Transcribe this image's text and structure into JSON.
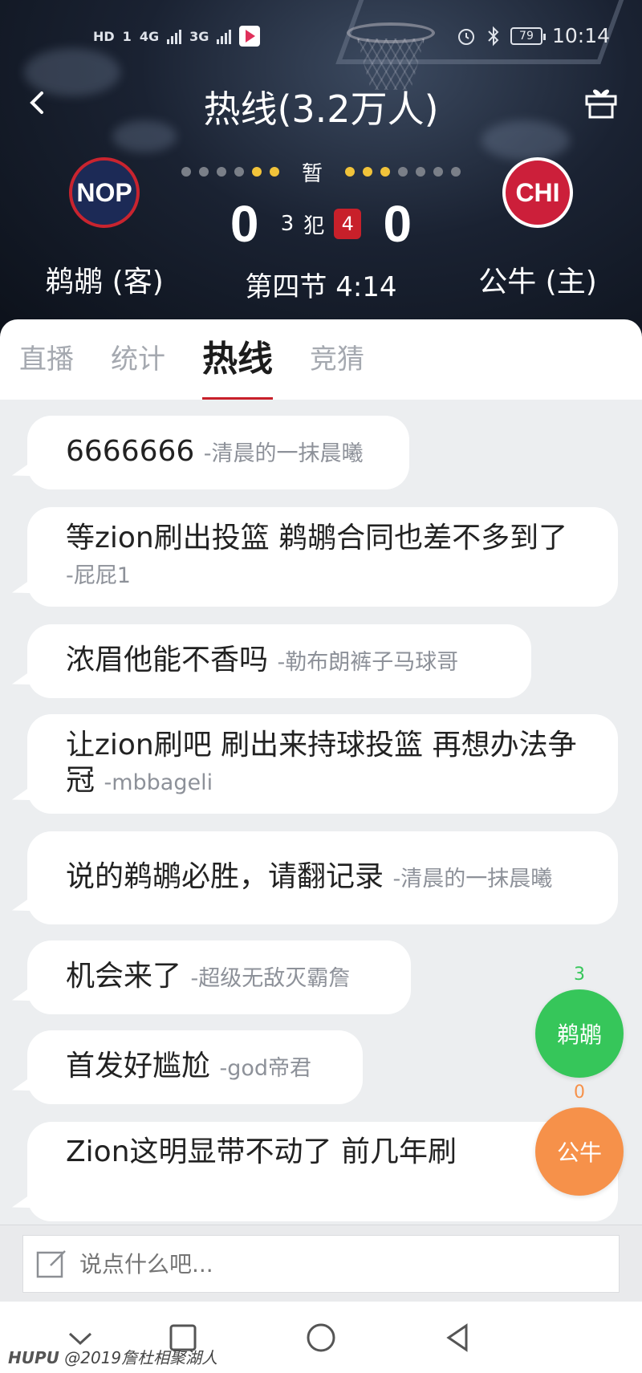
{
  "status_bar": {
    "left_chips": [
      "HD",
      "1",
      "4G",
      "3G"
    ],
    "battery": "79",
    "time": "10:14"
  },
  "nav": {
    "title": "热线(3.2万人)",
    "back_icon": "chevron-left-icon",
    "gift_icon": "gift-icon"
  },
  "game": {
    "away": {
      "abbr": "NOP",
      "name": "鹈鹕 (客)",
      "score": "0"
    },
    "home": {
      "abbr": "CHI",
      "name": "公牛 (主)",
      "score": "0"
    },
    "status": "暂",
    "foul_away": "3",
    "foul_label": "犯",
    "foul_home": "4",
    "period_clock": "第四节 4:14",
    "timeouts_left": {
      "gray": 4,
      "yellow": 2
    },
    "timeouts_right": {
      "yellow": 3,
      "gray": 4
    }
  },
  "tabs": [
    {
      "label": "直播",
      "active": false
    },
    {
      "label": "统计",
      "active": false
    },
    {
      "label": "热线",
      "active": true
    },
    {
      "label": "竞猜",
      "active": false
    }
  ],
  "messages": [
    {
      "text": "6666666",
      "user": "-清晨的一抹晨曦"
    },
    {
      "text": "等zion刷出投篮 鹈鹕合同也差不多到了",
      "user": "-屁屁1"
    },
    {
      "text": "浓眉他能不香吗",
      "user": "-勒布朗裤子马球哥"
    },
    {
      "text": "让zion刷吧  刷出来持球投篮 再想办法争冠",
      "user": "-mbbageli"
    },
    {
      "text": "说的鹈鹕必胜，请翻记录",
      "user": "-清晨的一抹晨曦"
    },
    {
      "text": "机会来了",
      "user": "-超级无敌灭霸詹"
    },
    {
      "text": "首发好尴尬",
      "user": "-god帝君"
    },
    {
      "text": "Zion这明显带不动了           前几年刷",
      "user": ""
    }
  ],
  "votes": {
    "away": {
      "label": "鹈鹕",
      "count": "3",
      "color": "#36c65a"
    },
    "home": {
      "label": "公牛",
      "count": "0",
      "color": "#f6914a"
    }
  },
  "input": {
    "placeholder": "说点什么吧..."
  },
  "watermark": {
    "brand": "HUPU",
    "text": "@2019詹杜相聚湖人"
  },
  "colors": {
    "accent": "#c8202a",
    "timeout_yellow": "#f1c33a"
  }
}
